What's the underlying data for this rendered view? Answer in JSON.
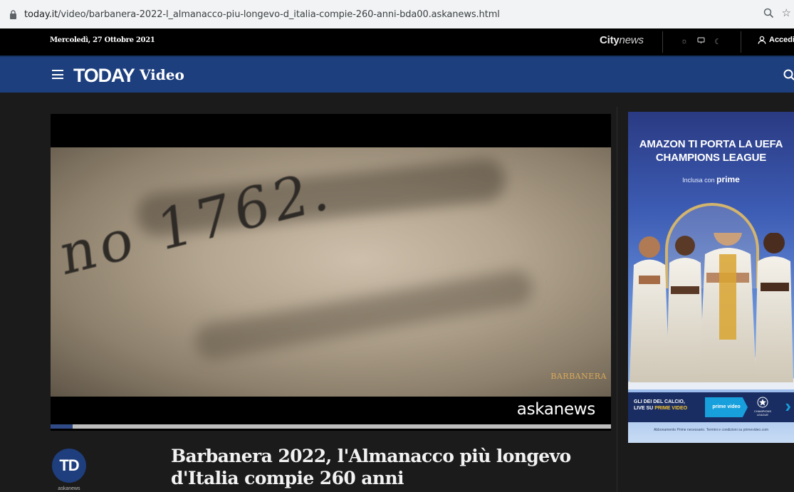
{
  "browser": {
    "url_host": "today.it",
    "url_path": "/video/barbanera-2022-l_almanacco-piu-longevo-d_italia-compie-260-anni-bda00.askanews.html"
  },
  "topbar": {
    "date": "Mercoledì, 27 Ottobre 2021",
    "network_prefix": "City",
    "network_suffix": "news",
    "account_label": "Accedi"
  },
  "nav": {
    "logo": "TODAY",
    "section": "Video"
  },
  "video": {
    "frame_text": "no 1762.",
    "frame_brand": "BARBANERA",
    "watermark": "askanews",
    "progress_fraction": 0.04
  },
  "article": {
    "source_initials": "TD",
    "source_name": "askanews",
    "headline": "Barbanera 2022, l'Almanacco più longevo d'Italia compie 260 anni"
  },
  "ad": {
    "headline": "AMAZON TI PORTA LA UEFA CHAMPIONS LEAGUE",
    "sub_prefix": "Inclusa con",
    "sub_brand": "prime",
    "banner_line1": "GLI DEI DEL CALCIO,",
    "banner_line2_prefix": "LIVE SU",
    "banner_line2_brand": "PRIME VIDEO",
    "pv_label": "prime video",
    "ucl_label": "CHAMPIONS LEAGUE",
    "fine_print": "Abbonamento Prime necessario. Termini e condizioni su primevideo.com"
  },
  "colors": {
    "nav_blue": "#1d3f7d",
    "progress_played": "#2f4a85",
    "ad_banner": "#1a2d62",
    "prime_video_blue": "#17a0dc"
  }
}
